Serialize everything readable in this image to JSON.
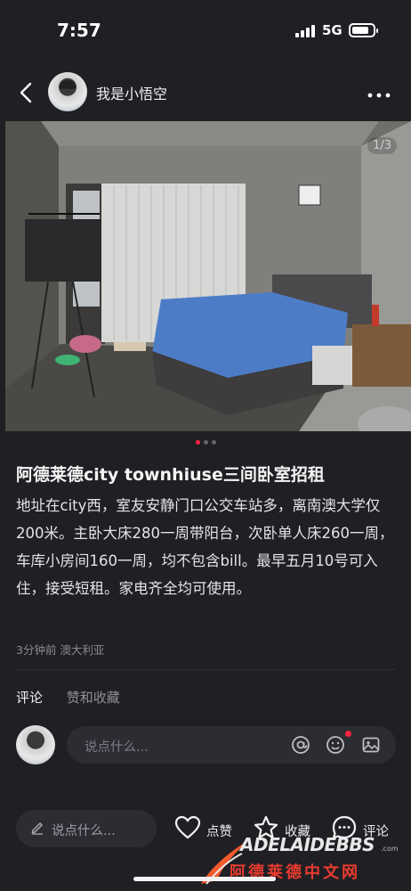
{
  "status_bar": {
    "time": "7:57",
    "network": "5G"
  },
  "header": {
    "username": "我是小悟空"
  },
  "post": {
    "image_counter": "1/3",
    "title": "阿德莱德city townhiuse三间卧室招租",
    "body": "地址在city西，室友安静门口公交车站多，离南澳大学仅200米。主卧大床280一周带阳台，次卧单人床260一周，车库小房间160一周，均不包含bill。最早五月10号可入住，接受短租。家电齐全均可使用。",
    "meta": "3分钟前 澳大利亚"
  },
  "comments": {
    "tabs": [
      {
        "label": "评论"
      },
      {
        "label": "赞和收藏"
      }
    ],
    "placeholder": "说点什么..."
  },
  "bottom_bar": {
    "input_placeholder": "说点什么...",
    "like_label": "点赞",
    "collect_label": "收藏",
    "comment_label": "评论"
  },
  "watermark": {
    "brand": "ADELAIDEBBS",
    "domain": ".com",
    "site": "阿德莱德中文网"
  },
  "colors": {
    "accent": "#ff2442",
    "background": "#1f1f24"
  }
}
